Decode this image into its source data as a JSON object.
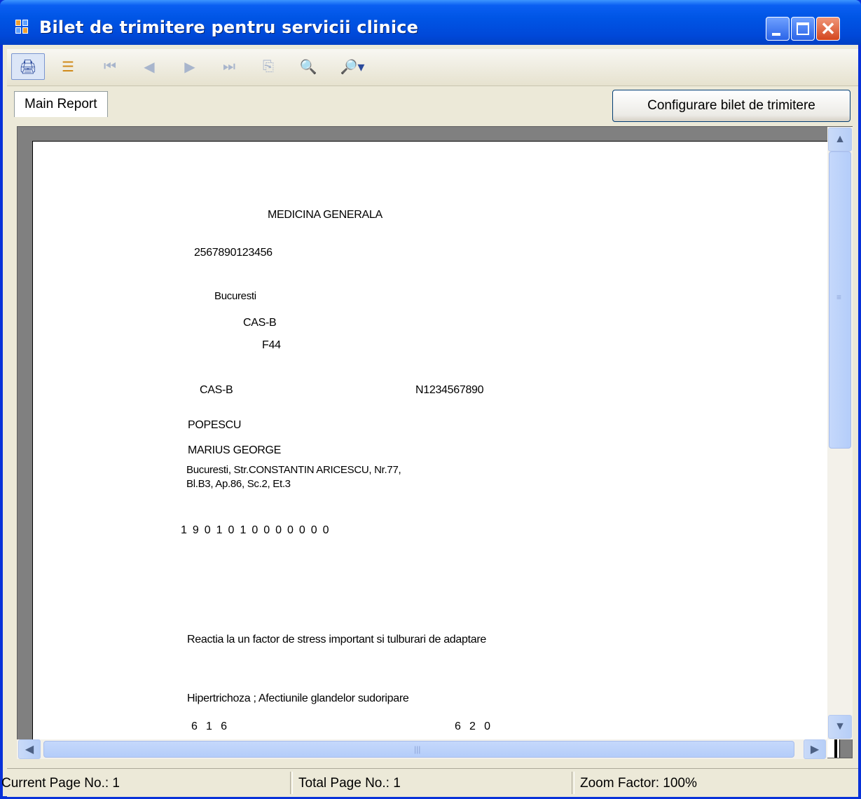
{
  "window": {
    "title": "Bilet de trimitere pentru servicii clinice"
  },
  "toolbar": {
    "tools": [
      {
        "name": "print-icon",
        "glyph": "🖨"
      },
      {
        "name": "group-tree-icon",
        "glyph": "☰"
      },
      {
        "name": "first-page-icon",
        "glyph": "⏮"
      },
      {
        "name": "prev-page-icon",
        "glyph": "◀"
      },
      {
        "name": "next-page-icon",
        "glyph": "▶"
      },
      {
        "name": "last-page-icon",
        "glyph": "⏭"
      },
      {
        "name": "goto-page-icon",
        "glyph": "⎘"
      },
      {
        "name": "find-icon",
        "glyph": "🔍"
      },
      {
        "name": "zoom-icon",
        "glyph": "🔎▾"
      }
    ]
  },
  "tabs": {
    "main": "Main Report"
  },
  "buttons": {
    "configure": "Configurare bilet de trimitere"
  },
  "report": {
    "specialty": "MEDICINA GENERALA",
    "code": "2567890123456",
    "city": "Bucuresti",
    "cas_top": "CAS-B",
    "code_f": "F44",
    "cas_left": "CAS-B",
    "number": "N1234567890",
    "last_name": "POPESCU",
    "first_name": "MARIUS GEORGE",
    "address_line1": "Bucuresti, Str.CONSTANTIN ARICESCU, Nr.77,",
    "address_line2": "Bl.B3, Ap.86, Sc.2, Et.3",
    "digits": "1  9  0  1  0  1  0  0  0  0  0  0  0",
    "diagnosis1": "Reactia la un factor de stress important si tulburari de adaptare",
    "diagnosis2": "Hipertrichoza ; Afectiunile glandelor sudoripare",
    "code_left": "6   1   6",
    "code_right": "6   2   0"
  },
  "status": {
    "current_page": "Current Page No.: 1",
    "total_pages": "Total Page No.: 1",
    "zoom": "Zoom Factor: 100%"
  }
}
